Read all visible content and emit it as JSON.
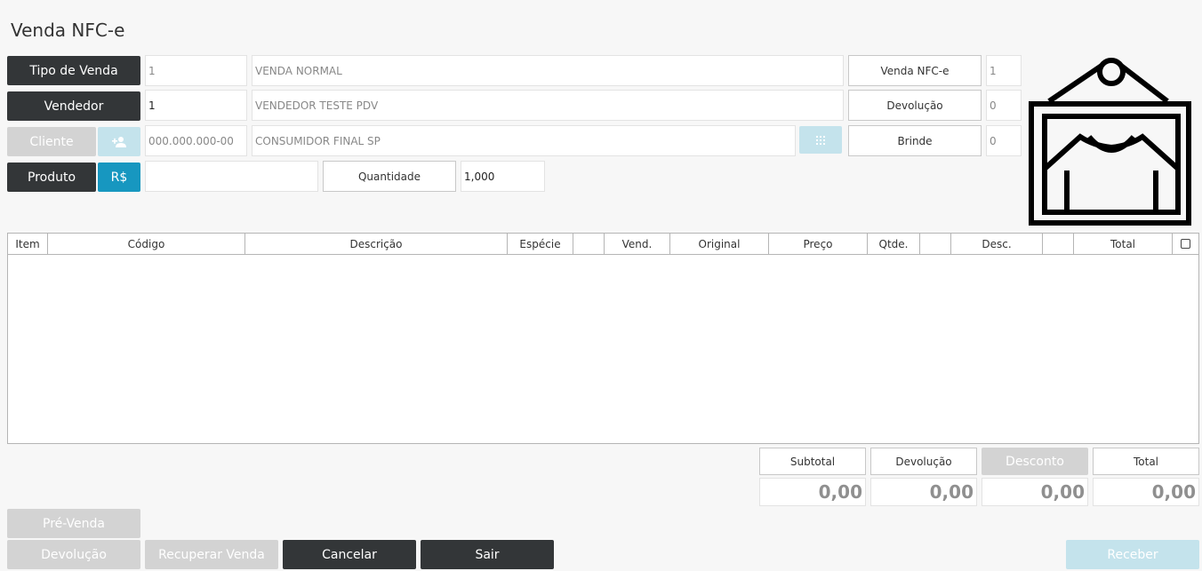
{
  "window": {
    "title": "Venda NFC-e"
  },
  "form": {
    "tipo_venda": {
      "button": "Tipo de Venda",
      "code": "1",
      "description": "VENDA NORMAL"
    },
    "vendedor": {
      "button": "Vendedor",
      "code": "1",
      "description": "VENDEDOR TESTE PDV"
    },
    "cliente": {
      "button": "Cliente",
      "document_placeholder": "000.000.000-00",
      "description": "CONSUMIDOR FINAL SP"
    },
    "produto": {
      "button": "Produto",
      "price_button": "R$",
      "code": "",
      "quantity_label": "Quantidade",
      "quantity": "1,000"
    }
  },
  "counters": [
    {
      "label": "Venda NFC-e",
      "value": "1"
    },
    {
      "label": "Devolução",
      "value": "0"
    },
    {
      "label": "Brinde",
      "value": "0"
    }
  ],
  "grid": {
    "columns": [
      "Item",
      "Código",
      "Descrição",
      "Espécie",
      "",
      "Vend.",
      "Original",
      "Preço",
      "Qtde.",
      "",
      "Desc.",
      "",
      "Total"
    ],
    "rows": []
  },
  "totals": {
    "subtotal": {
      "label": "Subtotal",
      "value": "0,00"
    },
    "devolucao": {
      "label": "Devolução",
      "value": "0,00"
    },
    "desconto": {
      "label": "Desconto",
      "value": "0,00"
    },
    "total": {
      "label": "Total",
      "value": "0,00"
    }
  },
  "actions": {
    "pre_venda": "Pré-Venda",
    "devolucao": "Devolução",
    "recuperar": "Recuperar Venda",
    "cancelar": "Cancelar",
    "sair": "Sair",
    "receber": "Receber"
  },
  "icons": {
    "store_logo": "shirt-frame-icon",
    "add_customer": "add-user-icon",
    "keypad": "keypad-icon",
    "select_all": "checkbox-icon"
  },
  "colors": {
    "dark_button": "#333638",
    "disabled_button": "#d3d3d3",
    "accent_blue": "#1797c0",
    "disabled_blue": "#c4e3ec"
  }
}
